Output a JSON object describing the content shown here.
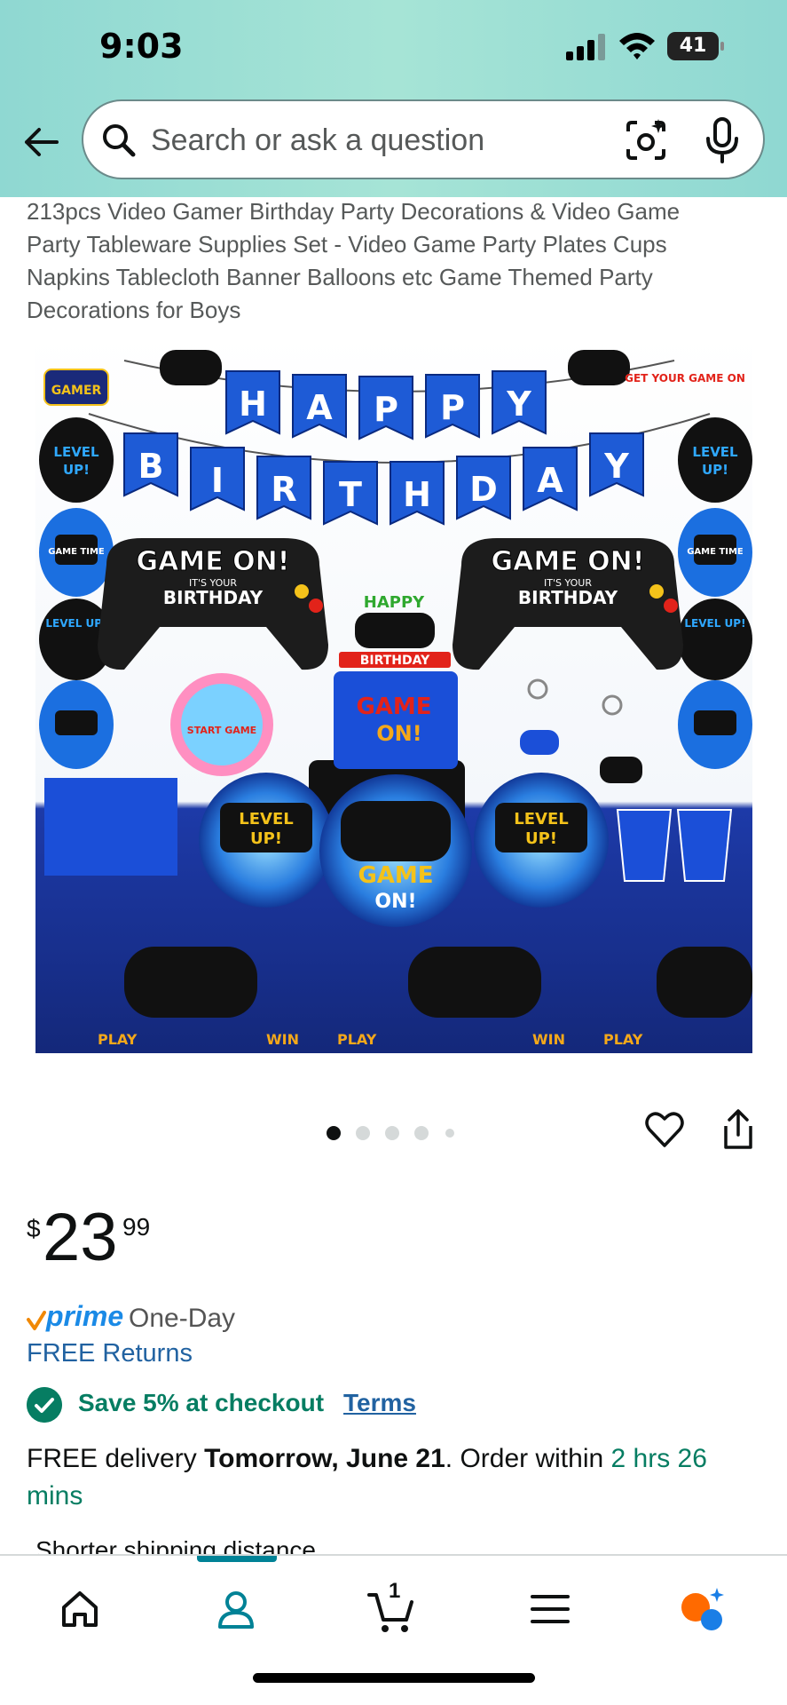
{
  "status_bar": {
    "time": "9:03",
    "battery": "41"
  },
  "search": {
    "placeholder": "Search or ask a question"
  },
  "product": {
    "title": "213pcs Video Gamer Birthday Party Decorations & Video Game Party Tableware Supplies Set - Video Game Party Plates Cups Napkins Tablecloth Banner Balloons etc Game Themed Party Decorations for Boys",
    "image_text": {
      "banner_row1": [
        "H",
        "A",
        "P",
        "P",
        "Y"
      ],
      "banner_row2": [
        "B",
        "I",
        "R",
        "T",
        "H",
        "D",
        "A",
        "Y"
      ],
      "game_on": "GAME ON!",
      "its_your": "IT'S YOUR",
      "birthday": "BIRTHDAY",
      "level_up": "LEVEL UP!",
      "level": "LEVEL",
      "up": "UP!",
      "game": "GAME",
      "on": "ON!",
      "game_time": "GAME TIME",
      "happy": "HAPPY",
      "birthday_topper": "BIRTHDAY",
      "gamer": "GAMER",
      "get_your_game_on": "GET YOUR GAME ON",
      "play": "PLAY",
      "win": "WIN",
      "start_game": "START GAME"
    },
    "image_count": 5,
    "active_image_index": 0
  },
  "price": {
    "symbol": "$",
    "whole": "23",
    "fraction": "99"
  },
  "prime": {
    "label": "prime",
    "speed": "One-Day"
  },
  "returns": "FREE Returns",
  "savings": {
    "text": "Save 5% at checkout",
    "terms": "Terms"
  },
  "delivery": {
    "prefix": "FREE delivery ",
    "date": "Tomorrow, June 21",
    "middle": ". Order within ",
    "countdown": "2 hrs 26 mins"
  },
  "shipping_note": "Shorter shipping distance",
  "nav": {
    "cart_count": "1",
    "active": "account"
  },
  "colors": {
    "accent_teal": "#008296",
    "link_blue": "#2162a1",
    "prime_blue": "#1a8ae6",
    "save_green": "#067d62"
  }
}
